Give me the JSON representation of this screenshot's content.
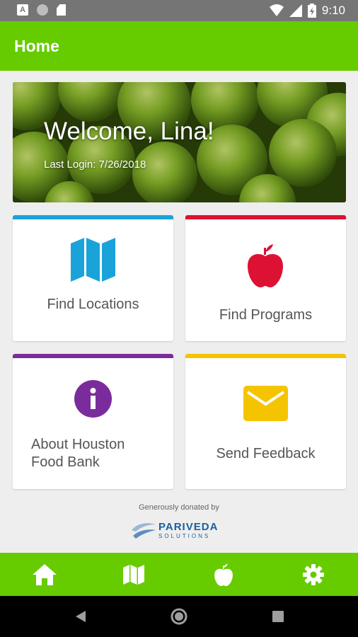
{
  "status_bar": {
    "time": "9:10",
    "notif_letter": "A"
  },
  "app_bar": {
    "title": "Home"
  },
  "banner": {
    "welcome": "Welcome, Lina!",
    "last_login": "Last Login: 7/26/2018"
  },
  "tiles": [
    {
      "label": "Find Locations",
      "accent": "#1aa3d9",
      "icon": "map-icon"
    },
    {
      "label": "Find Programs",
      "accent": "#dd1133",
      "icon": "apple-icon"
    },
    {
      "label_line1": "About Houston",
      "label_line2": "Food Bank",
      "accent": "#7b2c9c",
      "icon": "info-icon"
    },
    {
      "label": "Send Feedback",
      "accent": "#f5c400",
      "icon": "mail-icon"
    }
  ],
  "footer": {
    "donated": "Generously donated by",
    "sponsor": "PARIVEDA",
    "sponsor_sub": "SOLUTIONS"
  },
  "bottom_nav": [
    {
      "icon": "home-icon"
    },
    {
      "icon": "map-icon"
    },
    {
      "icon": "apple-icon"
    },
    {
      "icon": "gear-icon"
    }
  ],
  "colors": {
    "brand_green": "#66cc00",
    "status_bar": "#757575"
  }
}
